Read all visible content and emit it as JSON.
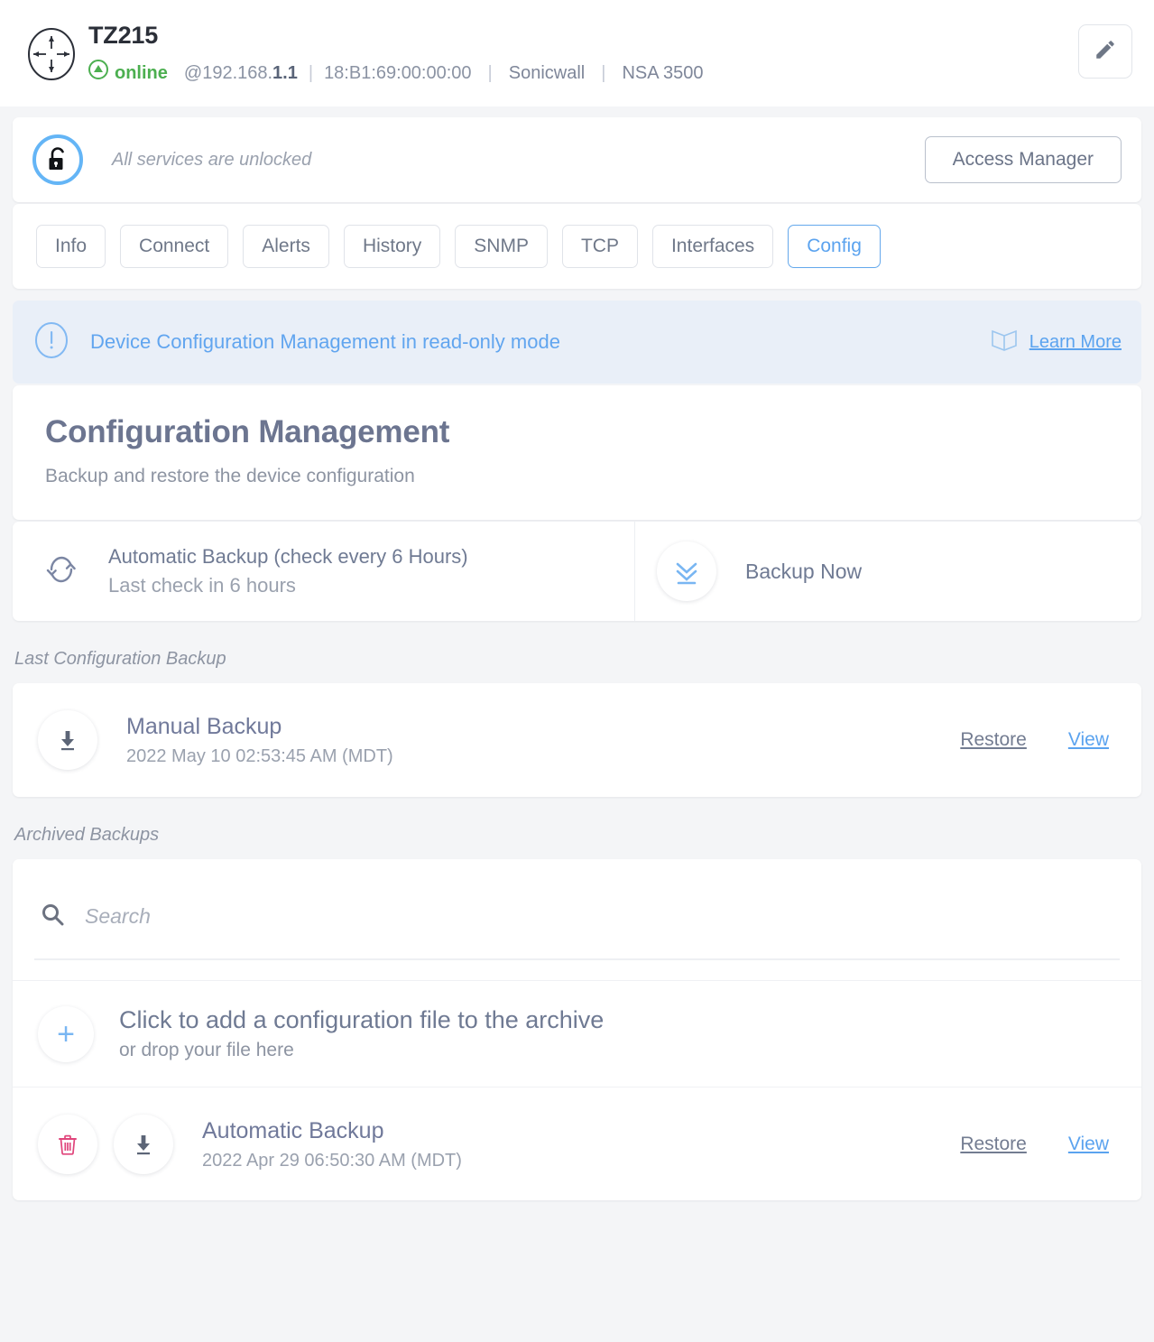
{
  "header": {
    "device_icon": "router-converge-icon",
    "device_name": "TZ215",
    "status": "online",
    "status_color": "#4caf50",
    "address_prefix": "@192.168.",
    "address_suffix": "1.1",
    "mac": "18:B1:69:00:00:00",
    "vendor": "Sonicwall",
    "model": "NSA 3500",
    "edit_icon": "pencil-icon"
  },
  "access": {
    "lock_icon": "unlocked-padlock-icon",
    "message": "All services are unlocked",
    "button_label": "Access Manager"
  },
  "tabs": [
    {
      "label": "Info",
      "active": false
    },
    {
      "label": "Connect",
      "active": false
    },
    {
      "label": "Alerts",
      "active": false
    },
    {
      "label": "History",
      "active": false
    },
    {
      "label": "SNMP",
      "active": false
    },
    {
      "label": "TCP",
      "active": false
    },
    {
      "label": "Interfaces",
      "active": false
    },
    {
      "label": "Config",
      "active": true
    }
  ],
  "notice": {
    "icon": "exclamation-circle-icon",
    "text": "Device Configuration Management in read-only mode",
    "link_icon": "book-icon",
    "link_label": "Learn More",
    "accent_color": "#5ba3ef",
    "background": "#e9eff8"
  },
  "main": {
    "title": "Configuration Management",
    "subtitle": "Backup and restore the device configuration"
  },
  "actions": {
    "auto_icon": "sync-refresh-icon",
    "auto_title": "Automatic Backup (check every 6 Hours)",
    "auto_sub": "Last check in 6 hours",
    "backup_now_icon": "download-chevrons-icon",
    "backup_now_label": "Backup Now"
  },
  "last_backup": {
    "section_label": "Last Configuration Backup",
    "download_icon": "download-icon",
    "name": "Manual Backup",
    "date": "2022 May 10 02:53:45 AM (MDT)",
    "restore_label": "Restore",
    "view_label": "View"
  },
  "archive": {
    "section_label": "Archived Backups",
    "search_icon": "search-icon",
    "search_value": "",
    "search_placeholder": "Search",
    "add_icon": "plus-icon",
    "add_title": "Click to add a configuration file to the archive",
    "add_sub": "or drop your file here",
    "items": [
      {
        "delete_icon": "trash-icon",
        "download_icon": "download-icon",
        "name": "Automatic Backup",
        "date": "2022 Apr 29 06:50:30 AM (MDT)",
        "restore_label": "Restore",
        "view_label": "View"
      }
    ]
  }
}
